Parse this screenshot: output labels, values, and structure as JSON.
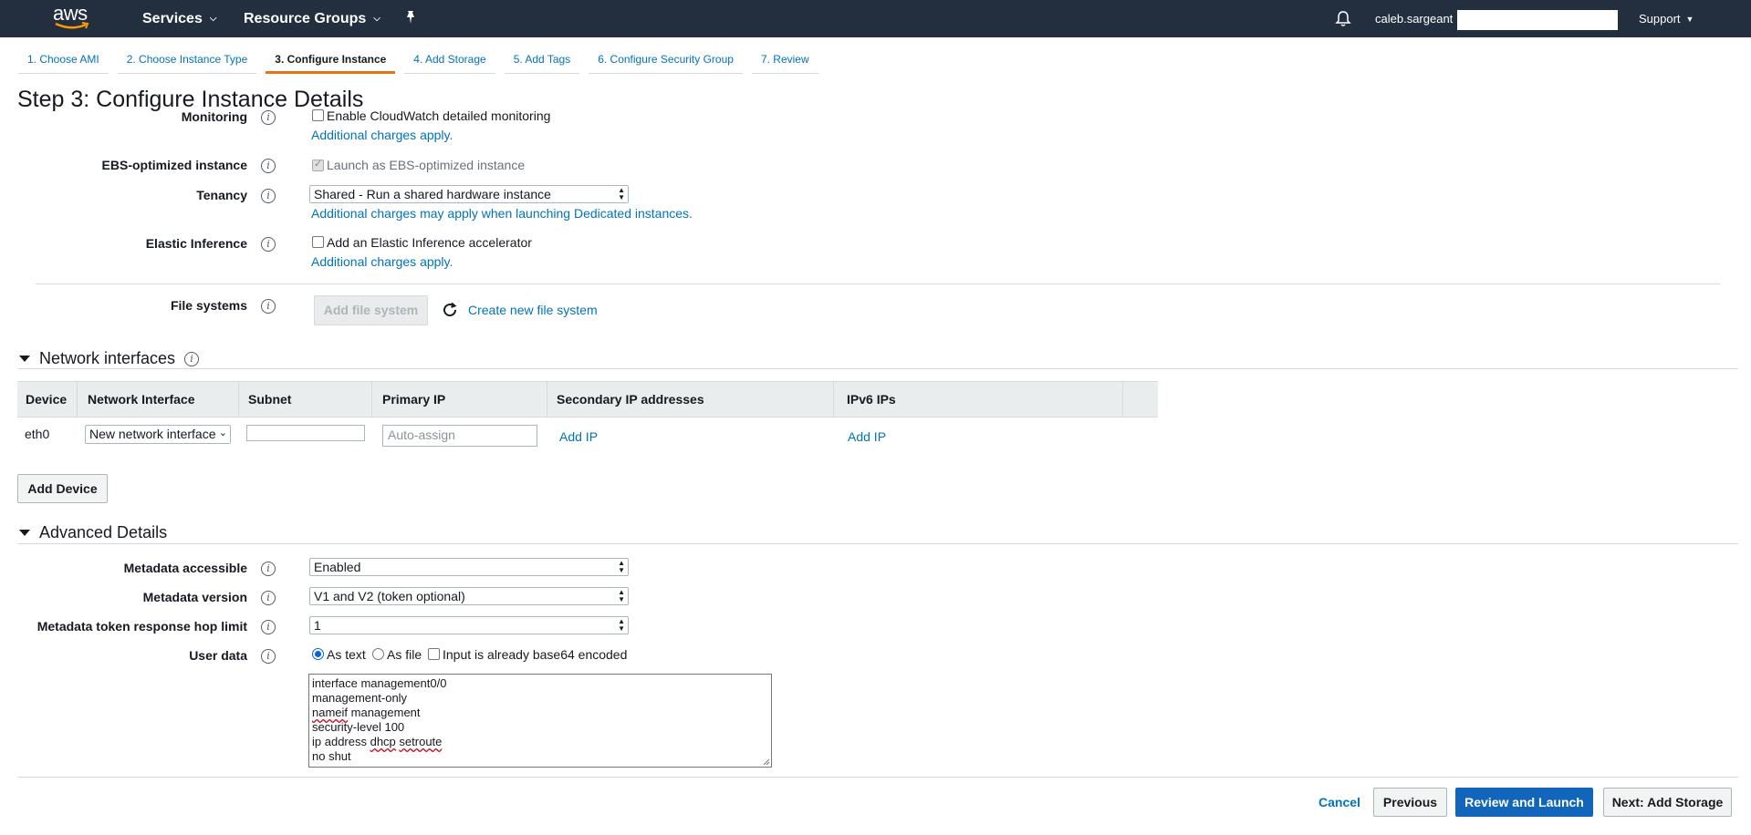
{
  "topnav": {
    "logo": "aws",
    "services": "Services",
    "resource_groups": "Resource Groups",
    "username": "caleb.sargeant",
    "support": "Support"
  },
  "wizard": {
    "tabs": [
      "1. Choose AMI",
      "2. Choose Instance Type",
      "3. Configure Instance",
      "4. Add Storage",
      "5. Add Tags",
      "6. Configure Security Group",
      "7. Review"
    ],
    "active_tab": 2
  },
  "page": {
    "title": "Step 3: Configure Instance Details"
  },
  "form": {
    "monitoring": {
      "label": "Monitoring",
      "checkbox_label": "Enable CloudWatch detailed monitoring",
      "checked": false,
      "link": "Additional charges apply."
    },
    "ebs": {
      "label": "EBS-optimized instance",
      "checkbox_label": "Launch as EBS-optimized instance",
      "checked": true,
      "disabled": true
    },
    "tenancy": {
      "label": "Tenancy",
      "value": "Shared - Run a shared hardware instance",
      "link": "Additional charges may apply when launching Dedicated instances."
    },
    "elastic_inference": {
      "label": "Elastic Inference",
      "checkbox_label": "Add an Elastic Inference accelerator",
      "checked": false,
      "link": "Additional charges apply."
    },
    "file_systems": {
      "label": "File systems",
      "add_button": "Add file system",
      "create_link": "Create new file system"
    }
  },
  "network_interfaces": {
    "title": "Network interfaces",
    "columns": [
      "Device",
      "Network Interface",
      "Subnet",
      "Primary IP",
      "Secondary IP addresses",
      "IPv6 IPs"
    ],
    "row": {
      "device": "eth0",
      "network_interface": "New network interface",
      "subnet": "",
      "primary_ip_placeholder": "Auto-assign",
      "secondary_link": "Add IP",
      "ipv6_link": "Add IP"
    },
    "add_device_button": "Add Device"
  },
  "advanced": {
    "title": "Advanced Details",
    "metadata_accessible": {
      "label": "Metadata accessible",
      "value": "Enabled"
    },
    "metadata_version": {
      "label": "Metadata version",
      "value": "V1 and V2 (token optional)"
    },
    "hop_limit": {
      "label": "Metadata token response hop limit",
      "value": "1"
    },
    "user_data": {
      "label": "User data",
      "as_text": "As text",
      "as_file": "As file",
      "base64_label": "Input is already base64 encoded",
      "selected": "As text",
      "lines": [
        "interface management0/0",
        "management-only",
        "nameif management",
        "security-level 100",
        "ip address dhcp setroute",
        "no shut"
      ]
    }
  },
  "footer": {
    "cancel": "Cancel",
    "previous": "Previous",
    "review_launch": "Review and Launch",
    "next": "Next: Add Storage"
  },
  "colors": {
    "nav_bg": "#232f3e",
    "link": "#0073bb",
    "active_tab": "#ec7211",
    "primary_button": "#1166bb"
  }
}
